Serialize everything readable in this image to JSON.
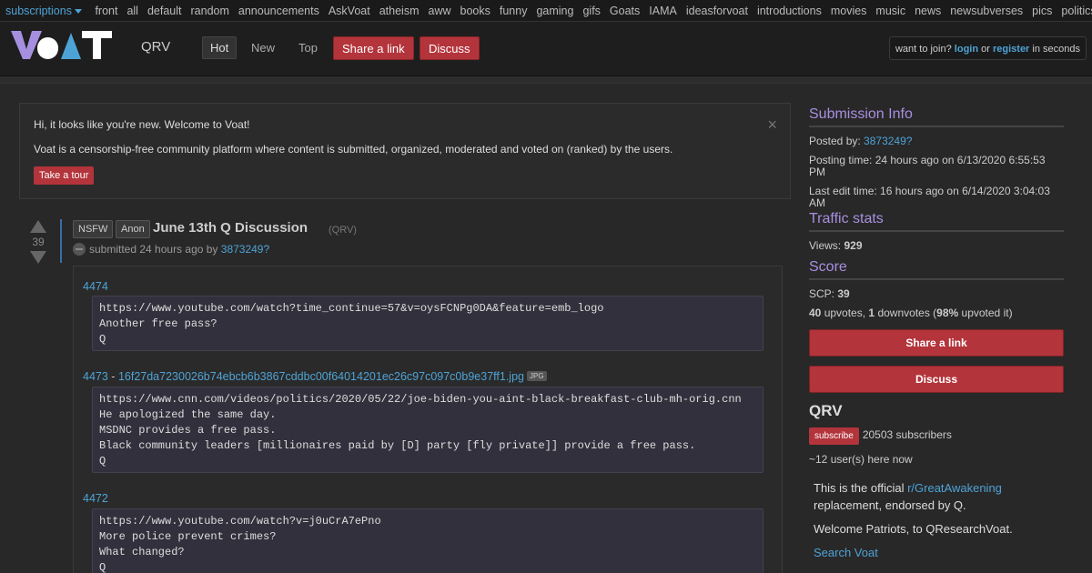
{
  "topbar": {
    "subscriptions_label": "subscriptions",
    "links": [
      "front",
      "all",
      "default",
      "random",
      "announcements",
      "AskVoat",
      "atheism",
      "aww",
      "books",
      "funny",
      "gaming",
      "gifs",
      "Goats",
      "IAMA",
      "ideasforvoat",
      "introductions",
      "movies",
      "music",
      "news",
      "newsubverses",
      "pics",
      "politics"
    ]
  },
  "header": {
    "logo_text": "VOAT",
    "subverse": "QRV",
    "tabs": [
      "Hot",
      "New",
      "Top"
    ],
    "share_label": "Share a link",
    "discuss_label": "Discuss",
    "join_prefix": "want to join?",
    "login": "login",
    "or": "or",
    "register": "register",
    "join_suffix": "in seconds"
  },
  "welcome": {
    "line1": "Hi, it looks like you're new. Welcome to Voat!",
    "line2": "Voat is a censorship-free community platform where content is submitted, organized, moderated and voted on (ranked) by the users.",
    "tour": "Take a tour",
    "close": "×"
  },
  "post": {
    "score": "39",
    "tags": [
      "NSFW",
      "Anon"
    ],
    "title": "June 13th Q Discussion",
    "subverse": "(QRV)",
    "submitted": "submitted 24 hours ago by",
    "author": "3873249?",
    "entries": [
      {
        "num": "4474",
        "link": "",
        "lines": "https://www.youtube.com/watch?time_continue=57&v=oysFCNPg0DA&feature=emb_logo\nAnother free pass?\nQ"
      },
      {
        "num": "4473",
        "link": "16f27da7230026b74ebcb6b3867cddbc00f64014201ec26c97c097c0b9e37ff1.jpg",
        "lines": "https://www.cnn.com/videos/politics/2020/05/22/joe-biden-you-aint-black-breakfast-club-mh-orig.cnn\nHe apologized the same day.\nMSDNC provides a free pass.\nBlack community leaders [millionaires paid by [D] party [fly private]] provide a free pass.\nQ"
      },
      {
        "num": "4472",
        "link": "",
        "lines": "https://www.youtube.com/watch?v=j0uCrA7ePno\nMore police prevent crimes?\nWhat changed?\nQ"
      }
    ],
    "jpg_badge": "JPG",
    "dash": "-"
  },
  "sidebar": {
    "info_title": "Submission Info",
    "posted_by_label": "Posted by:",
    "posted_by": "3873249?",
    "posting_time": "Posting time: 24 hours ago on 6/13/2020 6:55:53 PM",
    "edit_time": "Last edit time: 16 hours ago on 6/14/2020 3:04:03 AM",
    "traffic_title": "Traffic stats",
    "views_label": "Views:",
    "views": "929",
    "score_title": "Score",
    "scp_label": "SCP:",
    "scp": "39",
    "upvotes": "40",
    "upvotes_label": "upvotes,",
    "downvotes": "1",
    "downvotes_label": "downvotes (",
    "pct": "98%",
    "pct_label": "upvoted it)",
    "share_label": "Share a link",
    "discuss_label": "Discuss",
    "sub_title": "QRV",
    "subscribe_label": "subscribe",
    "subscribers": "20503 subscribers",
    "here_now": "~12 user(s) here now",
    "desc1_pre": "This is the official",
    "desc1_link": "r/GreatAwakening",
    "desc1_post": "replacement, endorsed by Q.",
    "desc2": "Welcome Patriots, to QResearchVoat.",
    "search_link": "Search Voat"
  },
  "colors": {
    "accent_red": "#b3343b",
    "link_blue": "#4ea3d6",
    "heading_purple": "#a78fe0"
  }
}
